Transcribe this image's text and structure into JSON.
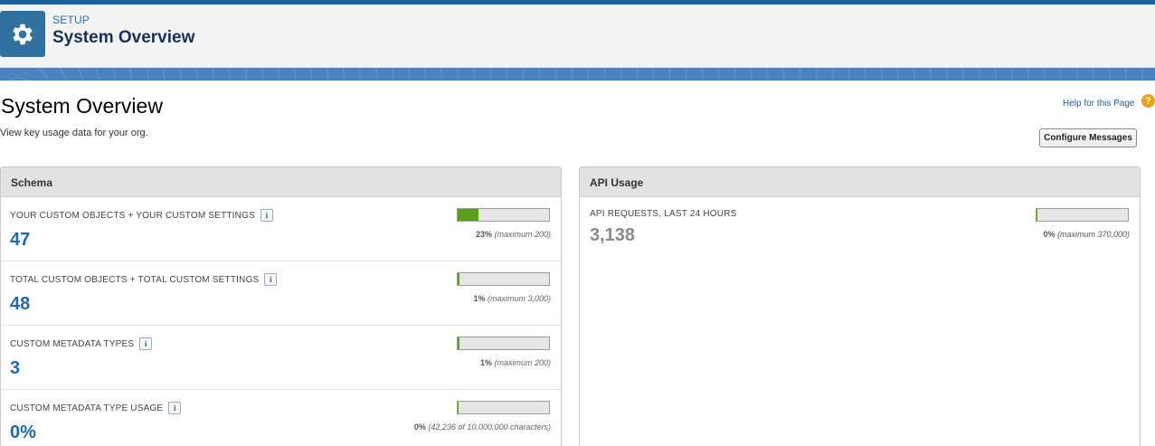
{
  "header": {
    "eyebrow": "SETUP",
    "title": "System Overview",
    "icon": "gear-icon"
  },
  "page": {
    "title": "System Overview",
    "subtitle": "View key usage data for your org.",
    "help_link": "Help for this Page",
    "help_icon": "?",
    "configure_button": "Configure Messages"
  },
  "schema": {
    "title": "Schema",
    "rows": [
      {
        "label": "YOUR CUSTOM OBJECTS + YOUR CUSTOM SETTINGS",
        "value": "47",
        "fill": 0.23,
        "pct": "23%",
        "max": "(maximum 200)"
      },
      {
        "label": "TOTAL CUSTOM OBJECTS + TOTAL CUSTOM SETTINGS",
        "value": "48",
        "fill": 0.01,
        "pct": "1%",
        "max": "(maximum 3,000)"
      },
      {
        "label": "CUSTOM METADATA TYPES",
        "value": "3",
        "fill": 0.01,
        "pct": "1%",
        "max": "(maximum 200)"
      },
      {
        "label": "CUSTOM METADATA TYPE USAGE",
        "value": "0%",
        "fill": 0.0,
        "pct": "0%",
        "max": "(42,236 of 10,000,000 characters)"
      }
    ]
  },
  "api": {
    "title": "API Usage",
    "label": "API REQUESTS, LAST 24 HOURS",
    "value": "3,138",
    "fill": 0.0,
    "pct": "0%",
    "max": "(maximum 370,000)"
  },
  "colors": {
    "accent": "#1e68b2",
    "bar_fill": "#5a9e1a",
    "header_icon_bg": "#31719f"
  }
}
